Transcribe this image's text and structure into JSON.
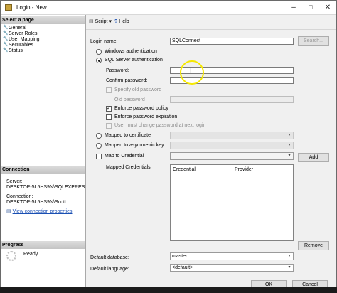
{
  "window": {
    "title": "Login - New"
  },
  "titlebar_buttons": {
    "minimize": "–",
    "maximize": "□",
    "close": "✕"
  },
  "left_panel": {
    "select_page_header": "Select a page",
    "pages": [
      {
        "label": "General"
      },
      {
        "label": "Server Roles"
      },
      {
        "label": "User Mapping"
      },
      {
        "label": "Securables"
      },
      {
        "label": "Status"
      }
    ],
    "connection_header": "Connection",
    "server_label": "Server:",
    "server_value": "DESKTOP-5L5HS9N\\SQLEXPRES",
    "connection_label": "Connection:",
    "connection_value": "DESKTOP-5L5HS9N\\Scott",
    "view_connection_link": "View connection properties",
    "progress_header": "Progress",
    "progress_status": "Ready"
  },
  "toolbar": {
    "script_label": "Script",
    "script_caret": "▾",
    "help_label": "Help"
  },
  "form": {
    "login_name_label": "Login name:",
    "login_name_value": "SQLConnect",
    "search_button": "Search...",
    "windows_auth_label": "Windows authentication",
    "sql_auth_label": "SQL Server authentication",
    "password_label": "Password:",
    "password_value": "",
    "confirm_password_label": "Confirm password:",
    "confirm_password_value": "",
    "specify_old_password_label": "Specify old password",
    "old_password_label": "Old password",
    "enforce_policy_label": "Enforce password policy",
    "enforce_policy_checked": "✓",
    "enforce_expiration_label": "Enforce password expiration",
    "must_change_label": "User must change password at next login",
    "mapped_cert_label": "Mapped to certificate",
    "mapped_asym_label": "Mapped to asymmetric key",
    "map_credential_label": "Map to Credential",
    "add_button": "Add",
    "mapped_credentials_label": "Mapped Credentials",
    "grid_columns": [
      "Credential",
      "Provider"
    ],
    "remove_button": "Remove",
    "default_database_label": "Default database:",
    "default_database_value": "master",
    "default_language_label": "Default language:",
    "default_language_value": "<default>",
    "combo_arrow": "▾"
  },
  "footer": {
    "ok_button": "OK",
    "cancel_button": "Cancel"
  }
}
